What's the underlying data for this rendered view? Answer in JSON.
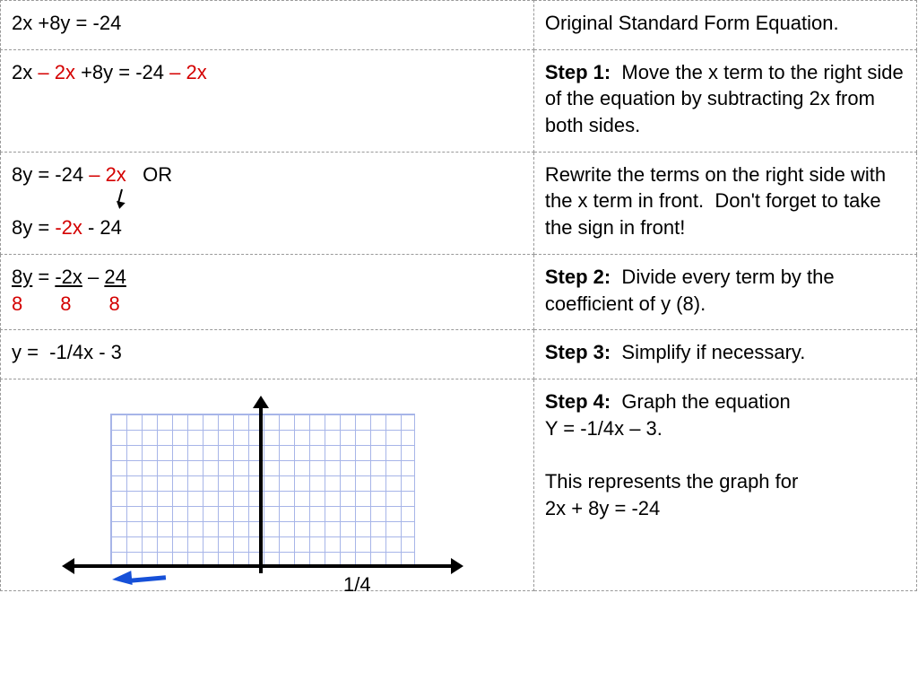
{
  "rows": [
    {
      "left_html": "2x +8y = -24",
      "right_html": "Original Standard Form Equation."
    },
    {
      "left_html": "2x <span class='red'>– 2x</span> +8y = -24 <span class='red'>– 2x</span>",
      "right_html": "<span class='b'>Step 1:</span>&nbsp; Move the x term to the right side of the equation by subtracting 2x from both sides."
    },
    {
      "left_html": "8y = -24 <span class='red'>– 2x</span>&nbsp;&nbsp; OR<br><span style='display:inline-block;width:112px;'></span><span class='arrow-dn'></span><br>8y = <span class='red'>-2x</span> - 24",
      "right_html": "Rewrite the terms on the right side with the x term in front.&nbsp; Don't forget to take the sign in front!"
    },
    {
      "left_html": "<span class='frac-line'>8y</span> = <span class='frac-line'>-2x</span> – <span class='frac-line'>24</span><br><span class='red'>8</span><span style='display:inline-block;width:42px'></span><span class='red'>8</span><span style='display:inline-block;width:42px'></span><span class='red'>8</span>",
      "right_html": "<span class='b'>Step 2:</span>&nbsp; Divide every term by the coefficient of y (8)."
    },
    {
      "left_html": "y =&nbsp; -1/4x - 3",
      "right_html": "<span class='b'>Step 3:</span>&nbsp; Simplify if necessary."
    },
    {
      "left_html": "__GRAPH__",
      "right_html": "<span class='b'>Step 4:</span>&nbsp; Graph the equation<br>Y = -1/4x – 3.<br><br>This represents the graph for<br>2x + 8y = -24"
    }
  ],
  "graph_bottom_text": "1/4"
}
